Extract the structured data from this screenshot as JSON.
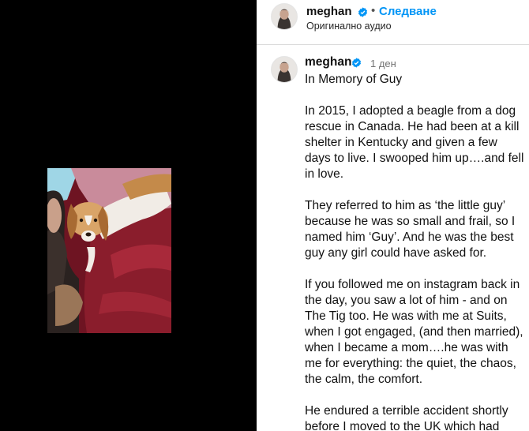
{
  "header": {
    "username": "meghan",
    "separator": "•",
    "follow_label": "Следване",
    "audio_label": "Оригинално аудио"
  },
  "post": {
    "username": "meghan",
    "time": "1 ден",
    "caption": [
      "In Memory of Guy",
      "In 2015, I adopted a beagle from a dog rescue in Canada. He had been at a kill shelter in Kentucky and given a few days to live. I swooped him up….and fell in love.",
      "They referred to him as ‘the little guy’ because he was so small and frail, so I named him ‘Guy’. And he was the best guy any girl could have asked for.",
      "If you followed me on instagram back in the day, you saw a lot of him - and on The Tig too. He was with me at Suits, when I got engaged, (and then married), when I became a mom….he was with me for everything: the quiet, the chaos, the calm, the comfort.",
      "He endured a terrible accident shortly before I moved to the UK which had"
    ]
  },
  "media": {
    "image_alt": "photo of a beagle with a woman on a red blanket"
  },
  "colors": {
    "accent": "#0095f6",
    "verified": "#0095f6",
    "media_bg": "#000000"
  },
  "icons": {
    "verified": "verified-badge-icon"
  }
}
